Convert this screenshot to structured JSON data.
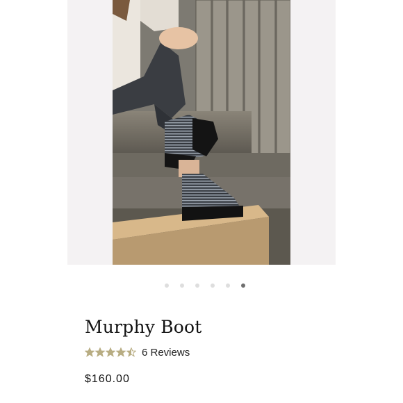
{
  "product": {
    "title": "Murphy Boot",
    "rating": 4.5,
    "rating_max": 5,
    "reviews_label": "6 Reviews",
    "price": "$160.00"
  },
  "gallery": {
    "slides": 6,
    "active_slide": 6
  },
  "colors": {
    "star": "#b8ad83",
    "dot_active": "#6f6f6f",
    "dot_inactive": "#dedede"
  }
}
